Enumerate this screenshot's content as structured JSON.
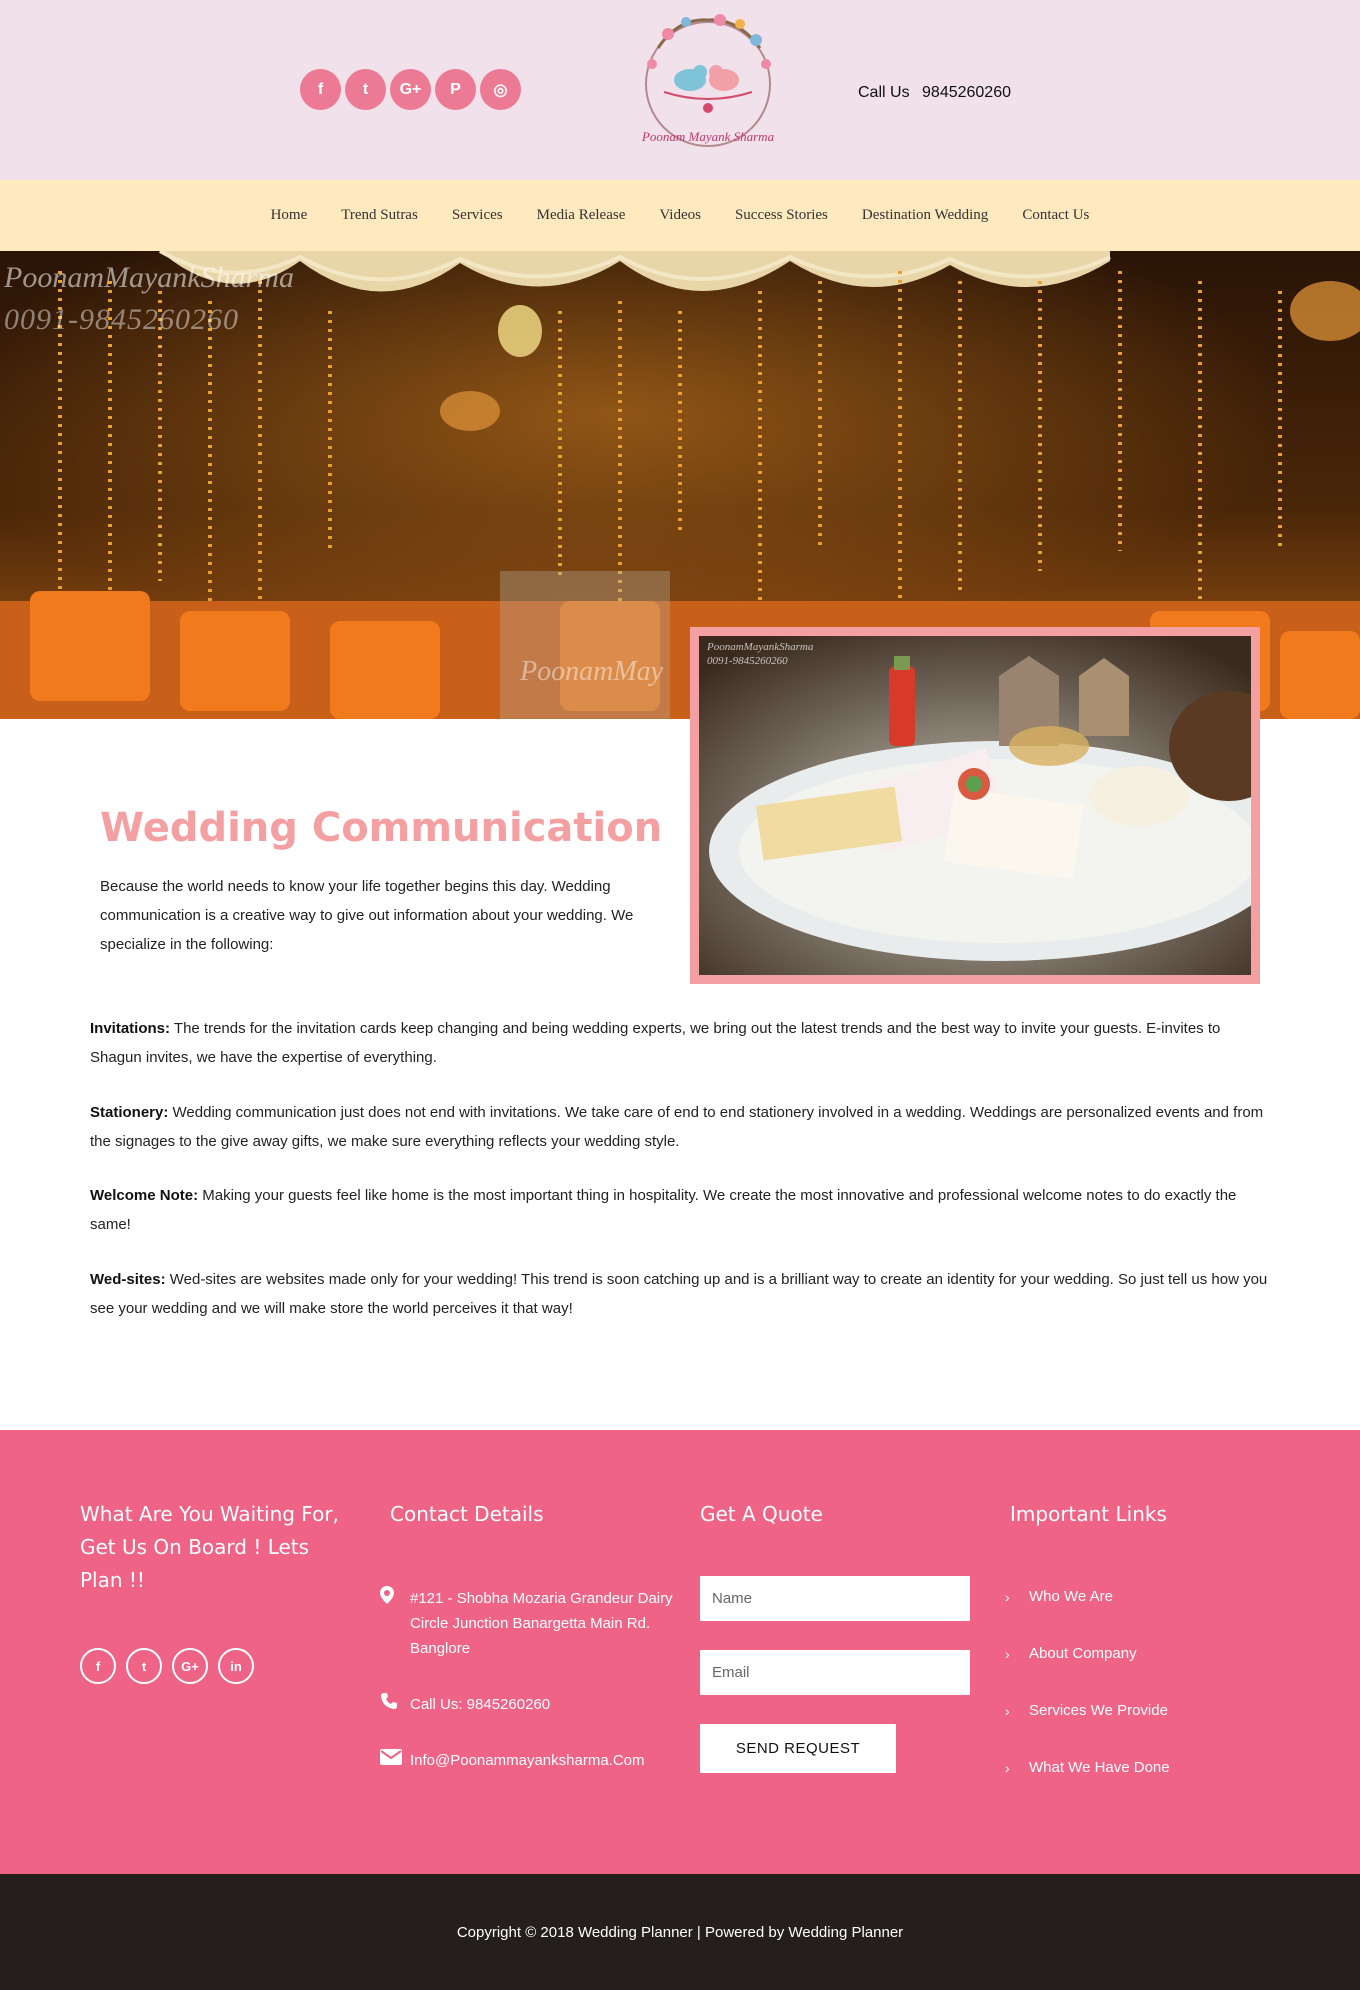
{
  "header": {
    "social": [
      {
        "icon": "facebook-icon",
        "glyph": "f"
      },
      {
        "icon": "twitter-icon",
        "glyph": "t"
      },
      {
        "icon": "google-plus-icon",
        "glyph": "G+"
      },
      {
        "icon": "pinterest-icon",
        "glyph": "P"
      },
      {
        "icon": "instagram-icon",
        "glyph": "◎"
      }
    ],
    "logo_text": "Poonam Mayank Sharma",
    "call_label": "Call Us",
    "call_number": "9845260260"
  },
  "nav": {
    "items": [
      "Home",
      "Trend Sutras",
      "Services",
      "Media Release",
      "Videos",
      "Success Stories",
      "Destination Wedding",
      "Contact Us"
    ]
  },
  "hero": {
    "watermark_name": "PoonamMayankSharma",
    "watermark_phone": "0091-9845260260",
    "watermark_partial": "PoonamMay"
  },
  "content": {
    "title": "Wedding Communication",
    "intro": "Because the world needs to know your life together begins this day. Wedding communication is a creative way to give out information about your wedding. We specialize in the following:",
    "features": [
      {
        "label": "Invitations:",
        "text": " The trends for the invitation cards keep changing and being wedding experts, we bring out the latest trends and the best way to invite your guests. E-invites to Shagun invites, we have the expertise of everything."
      },
      {
        "label": "Stationery:",
        "text": " Wedding communication just does not end with invitations. We take care of end to end stationery involved in a wedding. Weddings are personalized events and from the signages to the give away gifts, we make sure everything reflects your wedding style."
      },
      {
        "label": "Welcome Note:",
        "text": " Making your guests feel like home is the most important thing in hospitality. We create the most innovative and professional welcome notes to do exactly the same!"
      },
      {
        "label": "Wed-sites:",
        "text": " Wed-sites are websites made only for your wedding! This trend is soon catching up and is a brilliant way to create an identity for your wedding. So just tell us how you see your wedding and we will make store the world perceives it that way!"
      }
    ],
    "plate_watermark": "PoonamMayankSharma",
    "plate_phone": "0091-9845260260"
  },
  "footer": {
    "cta_title": "What Are You Waiting For, Get Us On Board ! Lets Plan !!",
    "social": [
      {
        "icon": "facebook-icon",
        "glyph": "f"
      },
      {
        "icon": "twitter-icon",
        "glyph": "t"
      },
      {
        "icon": "google-plus-icon",
        "glyph": "G+"
      },
      {
        "icon": "linkedin-icon",
        "glyph": "in"
      }
    ],
    "contact_title": "Contact Details",
    "address": "#121 - Shobha Mozaria Grandeur Dairy Circle Junction Banargetta Main Rd. Banglore",
    "phone": "Call Us: 9845260260",
    "email": "Info@Poonammayanksharma.Com",
    "quote_title": "Get A Quote",
    "name_placeholder": "Name",
    "email_placeholder": "Email",
    "send_label": "SEND REQUEST",
    "links_title": "Important Links",
    "links": [
      "Who We Are",
      "About Company",
      "Services We Provide",
      "What We Have Done"
    ]
  },
  "copyright": "Copyright © 2018 Wedding Planner | Powered by Wedding Planner"
}
